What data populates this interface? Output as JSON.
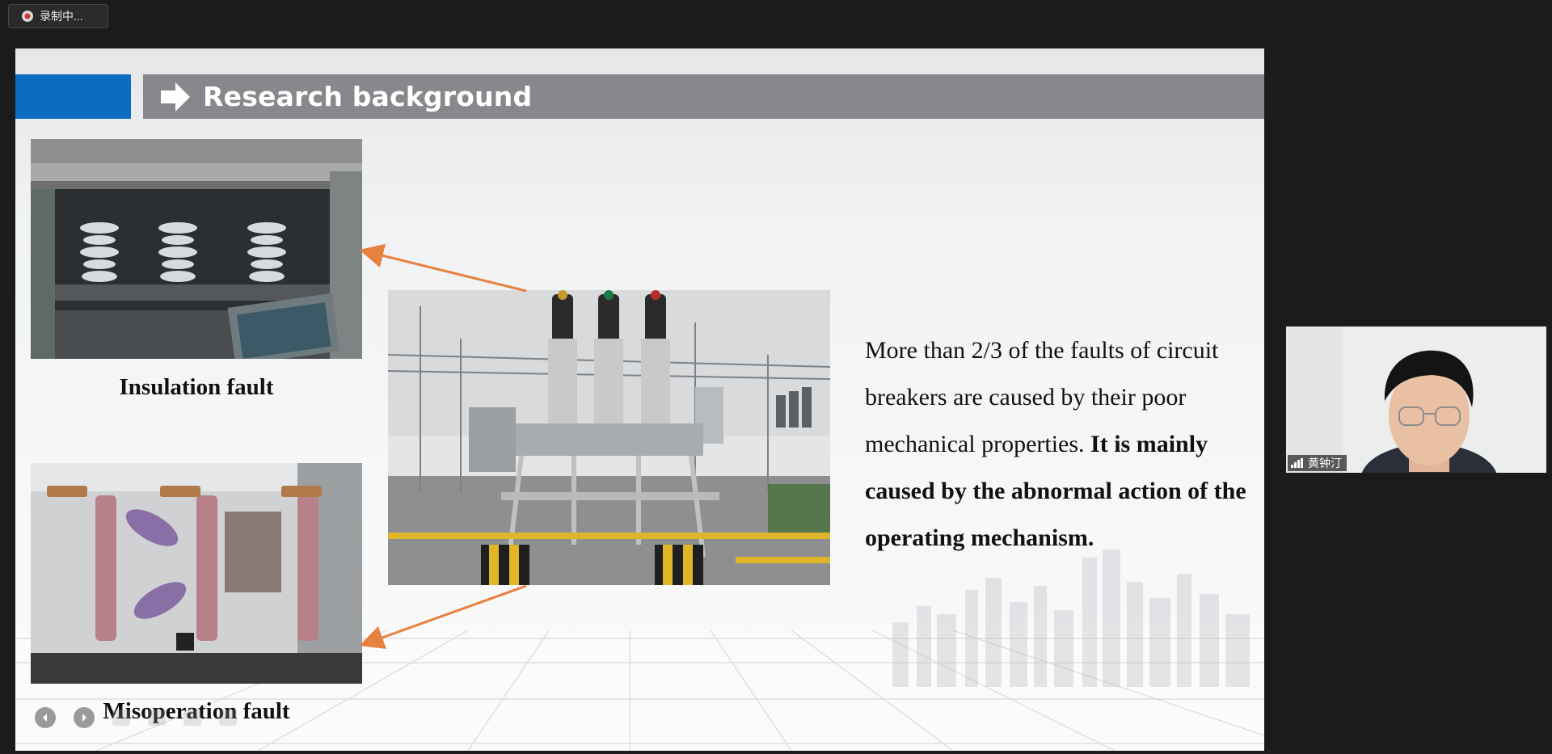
{
  "recording": {
    "label": "录制中..."
  },
  "slide": {
    "title": "Research background",
    "captions": {
      "top": "Insulation fault",
      "bottom": "Misoperation fault"
    },
    "body": {
      "normal": "More than 2/3 of the faults of circuit breakers are caused by their poor mechanical properties. ",
      "bold": "It is mainly caused by the abnormal action of the operating mechanism."
    },
    "colors": {
      "accent_blue": "#0b6cc2",
      "title_bar": "#86888b",
      "arrow": "#e8803f"
    }
  },
  "participant": {
    "name": "黄钟汀",
    "icon": "signal-icon"
  }
}
